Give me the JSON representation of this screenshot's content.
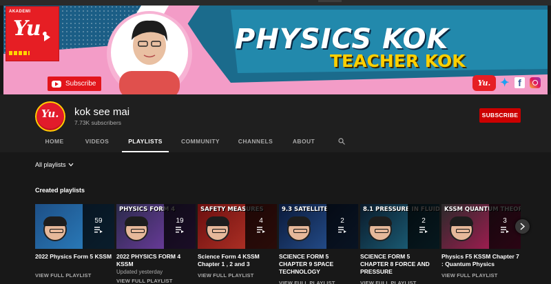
{
  "banner": {
    "academy_label": "AKADEMI",
    "title": "PHYSICS KOK",
    "subtitle": "TEACHER KOK",
    "subscribe_label": "Subscribe",
    "social": [
      "youtube-icon",
      "twitter-icon",
      "facebook-icon",
      "instagram-icon"
    ],
    "colors": {
      "pink": "#f39cc7",
      "teal": "#1b5e86",
      "red": "#e2151b",
      "yellow": "#ffd000"
    }
  },
  "channel": {
    "name": "kok see mai",
    "subscribers": "7.73K subscribers",
    "subscribe_label": "SUBSCRIBE"
  },
  "tabs": [
    {
      "label": "HOME"
    },
    {
      "label": "VIDEOS"
    },
    {
      "label": "PLAYLISTS",
      "active": true
    },
    {
      "label": "COMMUNITY"
    },
    {
      "label": "CHANNELS"
    },
    {
      "label": "ABOUT"
    }
  ],
  "filter": {
    "label": "All playlists"
  },
  "section": {
    "title": "Created playlists"
  },
  "playlists": [
    {
      "title": "2022 Physics Form 5 KSSM",
      "count": "59",
      "updated": "",
      "link": "VIEW FULL PLAYLIST",
      "thumb_text": "",
      "thumb_colors": [
        "#1d4f86",
        "#2d86c7"
      ]
    },
    {
      "title": "2022 PHYSICS FORM 4 KSSM",
      "count": "19",
      "updated": "Updated yesterday",
      "link": "VIEW FULL PLAYLIST",
      "thumb_text": "PHYSICS FORM 4",
      "thumb_colors": [
        "#2a2a4a",
        "#7b3fb0"
      ]
    },
    {
      "title": "Science Form 4 KSSM Chapter 1 , 2 and 3",
      "count": "4",
      "updated": "",
      "link": "VIEW FULL PLAYLIST",
      "thumb_text": "SAFETY MEASURES",
      "thumb_colors": [
        "#6b0f0f",
        "#c0392b"
      ]
    },
    {
      "title": "SCIENCE FORM 5 CHAPTER 9 SPACE TECHNOLOGY",
      "count": "2",
      "updated": "",
      "link": "VIEW FULL PLAYLIST",
      "thumb_text": "9.3 SATELLITE",
      "thumb_colors": [
        "#0b1a3a",
        "#2a5aa0"
      ]
    },
    {
      "title": "SCIENCE FORM 5 CHAPTER 8 FORCE AND PRESSURE",
      "count": "2",
      "updated": "",
      "link": "VIEW FULL PLAYLIST",
      "thumb_text": "8.1 PRESSURE IN FLUID",
      "thumb_colors": [
        "#0a1a2a",
        "#1f6f8a"
      ]
    },
    {
      "title": "Physics F5 KSSM Chapter 7 : Quantum Physics",
      "count": "3",
      "updated": "",
      "link": "VIEW FULL PLAYLIST",
      "thumb_text": "KSSM QUANTUM THEORY",
      "thumb_colors": [
        "#2a2a2a",
        "#c2185b"
      ]
    }
  ]
}
